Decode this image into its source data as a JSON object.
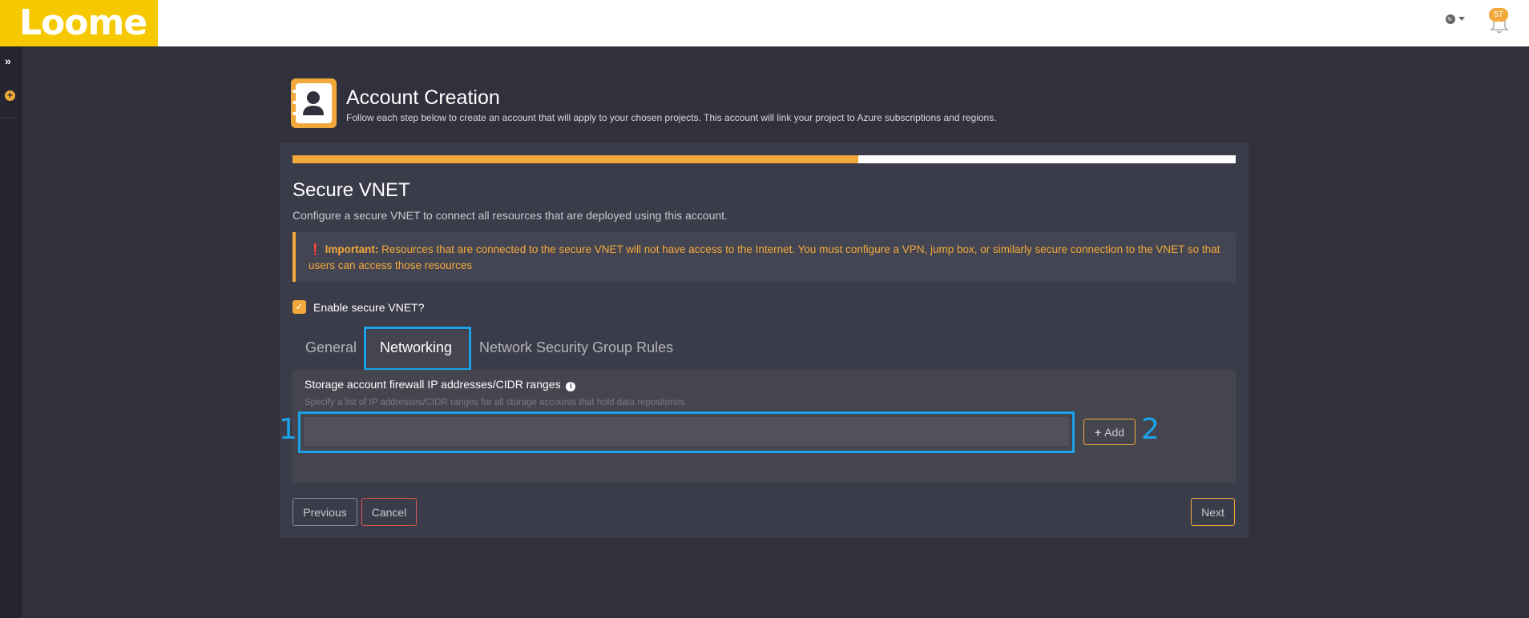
{
  "brand": {
    "logo_text": "Loome",
    "accent": "#f2a93b",
    "highlight": "#1aa3e8"
  },
  "topbar": {
    "globe_icon": "globe-icon",
    "notification_count": "57"
  },
  "sidebar": {
    "expand_icon": "double-chevron-right-icon",
    "add_icon": "plus-circle-icon"
  },
  "header": {
    "icon": "contact-book-icon",
    "title": "Account Creation",
    "subtitle": "Follow each step below to create an account that will apply to your chosen projects. This account will link your project to Azure subscriptions and regions."
  },
  "progress": {
    "fraction": 0.6
  },
  "section": {
    "title": "Secure VNET",
    "subtitle": "Configure a secure VNET to connect all resources that are deployed using this account."
  },
  "alert": {
    "prefix": "Important:",
    "message": "Resources that are connected to the secure VNET will not have access to the Internet. You must configure a VPN, jump box, or similarly secure connection to the VNET so that users can access those resources"
  },
  "checkbox": {
    "label": "Enable secure VNET?",
    "checked": true
  },
  "tabs": [
    {
      "label": "General",
      "active": false
    },
    {
      "label": "Networking",
      "active": true
    },
    {
      "label": "Network Security Group Rules",
      "active": false
    }
  ],
  "field": {
    "label": "Storage account firewall IP addresses/CIDR ranges",
    "help": "Specify a list of IP addresses/CIDR ranges for all storage accounts that hold data repositories",
    "value": "",
    "placeholder": ""
  },
  "markers": {
    "input": "1",
    "add": "2"
  },
  "buttons": {
    "add": "Add",
    "previous": "Previous",
    "cancel": "Cancel",
    "next": "Next"
  }
}
